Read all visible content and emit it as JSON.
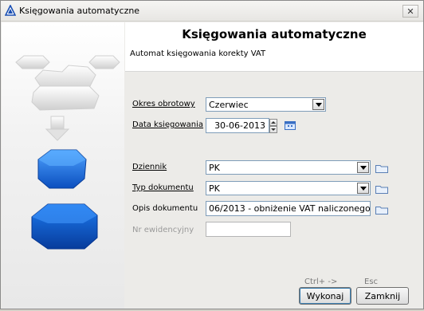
{
  "window": {
    "title": "Księgowania automatyczne"
  },
  "header": {
    "title": "Księgowania automatyczne",
    "subtitle": "Automat księgowania korekty VAT"
  },
  "form": {
    "okres": {
      "label": "Okres obrotowy",
      "value": "Czerwiec"
    },
    "data_ksiegowania": {
      "label": "Data księgowania",
      "value": "30-06-2013"
    },
    "dziennik": {
      "label": "Dziennik",
      "value": "PK"
    },
    "typ_dokumentu": {
      "label": "Typ dokumentu",
      "value": "PK"
    },
    "opis_dokumentu": {
      "label": "Opis dokumentu",
      "value": "06/2013 - obniżenie VAT naliczonego"
    },
    "nr_ewidencyjny": {
      "label": "Nr ewidencyjny",
      "value": ""
    }
  },
  "buttons": {
    "wykonaj": {
      "label": "Wykonaj",
      "shortcut": "Ctrl+ ->"
    },
    "zamknij": {
      "label": "Zamknij",
      "shortcut": "Esc"
    }
  },
  "colors": {
    "accent_blue": "#1f6fd6",
    "field_border": "#7f9db9"
  },
  "icons": [
    "app-triangle-icon",
    "close-icon",
    "calendar-icon",
    "folder-icon"
  ]
}
